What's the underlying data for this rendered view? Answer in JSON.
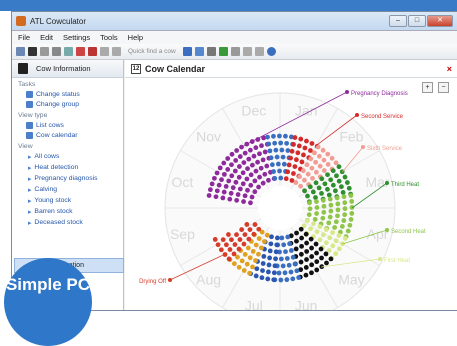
{
  "window": {
    "title": "ATL Cowculator"
  },
  "menu": [
    "File",
    "Edit",
    "Settings",
    "Tools",
    "Help"
  ],
  "toolbar": {
    "quick_placeholder": "Quick find a cow"
  },
  "left": {
    "header": "Cow Information",
    "tasks_label": "Tasks",
    "tasks": [
      "Change status",
      "Change group"
    ],
    "viewtype_label": "View type",
    "viewtypes": [
      "List cows",
      "Cow calendar"
    ],
    "view_label": "View",
    "views": [
      "All cows",
      "Heat detection",
      "Pregnancy diagnosis",
      "Calving",
      "Young stock",
      "Barren stock",
      "Deceased stock"
    ],
    "selected": "Cow Information"
  },
  "badge": "Simple PC",
  "main": {
    "title": "Cow Calendar",
    "close": "×"
  },
  "chart_data": {
    "type": "radial-calendar",
    "months": [
      "Jan",
      "Feb",
      "Mar",
      "Apr",
      "May",
      "Jun",
      "Jul",
      "Aug",
      "Sep",
      "Oct",
      "Nov",
      "Dec"
    ],
    "stages": [
      {
        "name": "Pregnancy Diagnosis",
        "color": "#8e2a9c"
      },
      {
        "name": "Second Service",
        "color": "#d42a2a"
      },
      {
        "name": "Sixth Service",
        "color": "#f29c93"
      },
      {
        "name": "Third Heat",
        "color": "#2e8f2e"
      },
      {
        "name": "Second Heat",
        "color": "#8fc54a"
      },
      {
        "name": "First Heat",
        "color": "#d6e88a"
      },
      {
        "name": "Drying Off",
        "color": "#d63c2a"
      }
    ]
  },
  "colors": {
    "accent": "#3a7bc8",
    "badge": "#2e77c9"
  }
}
